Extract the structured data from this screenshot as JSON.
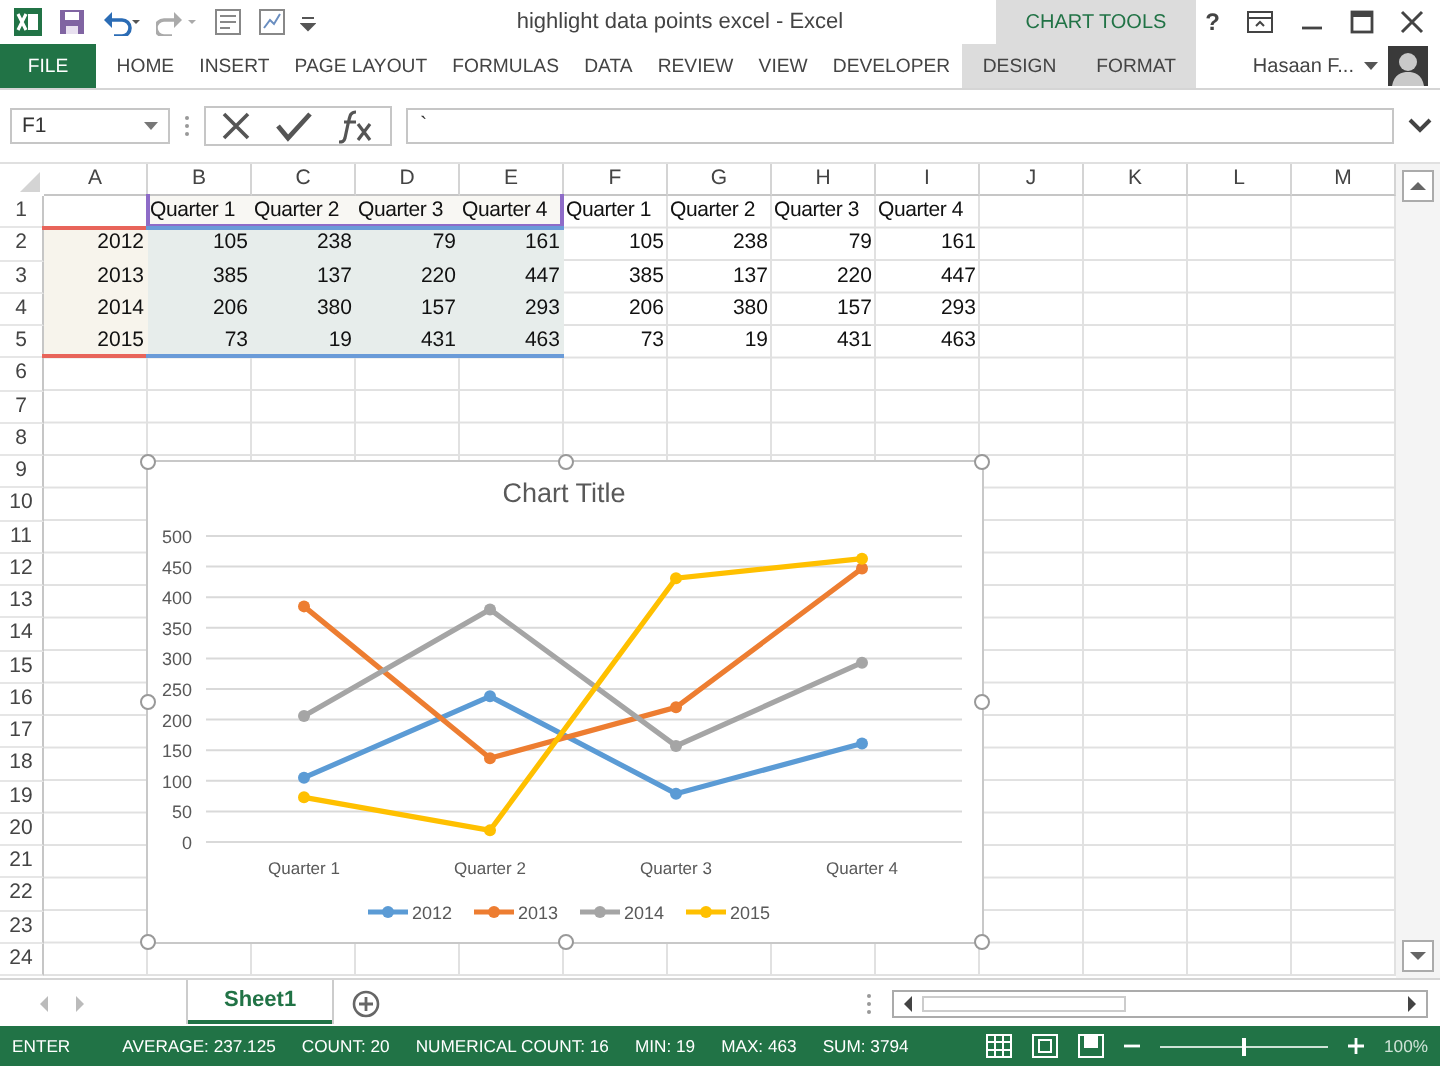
{
  "title_bar": {
    "title": "highlight data points excel - Excel",
    "context_tab": "CHART TOOLS",
    "help": "?"
  },
  "ribbon_tabs": [
    {
      "label": "FILE",
      "kind": "file"
    },
    {
      "label": "HOME",
      "kind": "tab"
    },
    {
      "label": "INSERT",
      "kind": "tab"
    },
    {
      "label": "PAGE LAYOUT",
      "kind": "tab"
    },
    {
      "label": "FORMULAS",
      "kind": "tab"
    },
    {
      "label": "DATA",
      "kind": "tab"
    },
    {
      "label": "REVIEW",
      "kind": "tab"
    },
    {
      "label": "VIEW",
      "kind": "tab"
    },
    {
      "label": "DEVELOPER",
      "kind": "tab"
    },
    {
      "label": "DESIGN",
      "kind": "context"
    },
    {
      "label": "FORMAT",
      "kind": "context"
    }
  ],
  "user": {
    "name": "Hasaan F..."
  },
  "formula_bar": {
    "name_box": "F1",
    "value": "`"
  },
  "columns": [
    "A",
    "B",
    "C",
    "D",
    "E",
    "F",
    "G",
    "H",
    "I",
    "J",
    "K",
    "L",
    "M"
  ],
  "rows": [
    {
      "number": "1",
      "kind": "header",
      "in_chart_range": true,
      "values": [
        "Quarter 1",
        "Quarter 2",
        "Quarter 3",
        "Quarter 4",
        "Quarter 1",
        "Quarter 2",
        "Quarter 3",
        "Quarter 4"
      ]
    },
    {
      "number": "2",
      "kind": "data",
      "in_chart_range": true,
      "label": "2012",
      "values": [
        "105",
        "238",
        "79",
        "161",
        "105",
        "238",
        "79",
        "161"
      ]
    },
    {
      "number": "3",
      "kind": "data",
      "in_chart_range": true,
      "label": "2013",
      "values": [
        "385",
        "137",
        "220",
        "447",
        "385",
        "137",
        "220",
        "447"
      ]
    },
    {
      "number": "4",
      "kind": "data",
      "in_chart_range": true,
      "label": "2014",
      "values": [
        "206",
        "380",
        "157",
        "293",
        "206",
        "380",
        "157",
        "293"
      ]
    },
    {
      "number": "5",
      "kind": "data",
      "in_chart_range": true,
      "label": "2015",
      "values": [
        "73",
        "19",
        "431",
        "463",
        "73",
        "19",
        "431",
        "463"
      ]
    },
    {
      "number": "6"
    },
    {
      "number": "7"
    },
    {
      "number": "8"
    },
    {
      "number": "9"
    },
    {
      "number": "10"
    },
    {
      "number": "11"
    },
    {
      "number": "12"
    },
    {
      "number": "13"
    },
    {
      "number": "14"
    },
    {
      "number": "15"
    },
    {
      "number": "16"
    },
    {
      "number": "17"
    },
    {
      "number": "18"
    },
    {
      "number": "19"
    },
    {
      "number": "20"
    },
    {
      "number": "21"
    },
    {
      "number": "22"
    },
    {
      "number": "23"
    },
    {
      "number": "24"
    }
  ],
  "chart": {
    "chart_data": {
      "type": "line",
      "title": "Chart Title",
      "categories": [
        "Quarter 1",
        "Quarter 2",
        "Quarter 3",
        "Quarter 4"
      ],
      "ylim": [
        0,
        500
      ],
      "yticks": [
        0,
        50,
        100,
        150,
        200,
        250,
        300,
        350,
        400,
        450,
        500
      ],
      "grid": true,
      "legend": true,
      "series": [
        {
          "name": "2012",
          "color": "#5b9bd5",
          "marker": "circle",
          "values": [
            105,
            238,
            79,
            161
          ]
        },
        {
          "name": "2013",
          "color": "#ed7d31",
          "marker": "circle",
          "values": [
            385,
            137,
            220,
            447
          ]
        },
        {
          "name": "2014",
          "color": "#a5a5a5",
          "marker": "circle",
          "values": [
            206,
            380,
            157,
            293
          ]
        },
        {
          "name": "2015",
          "color": "#ffc000",
          "marker": "circle",
          "values": [
            73,
            19,
            431,
            463
          ]
        }
      ]
    }
  },
  "sheet_tabs": [
    {
      "label": "Sheet1",
      "selected": true
    }
  ],
  "status_bar": {
    "mode": "ENTER",
    "stats": [
      "AVERAGE: 237.125",
      "COUNT: 20",
      "NUMERICAL COUNT: 16",
      "MIN: 19",
      "MAX: 463",
      "SUM: 3794"
    ],
    "zoom": "100%",
    "zoom_slider": {
      "level": 0.5
    }
  }
}
